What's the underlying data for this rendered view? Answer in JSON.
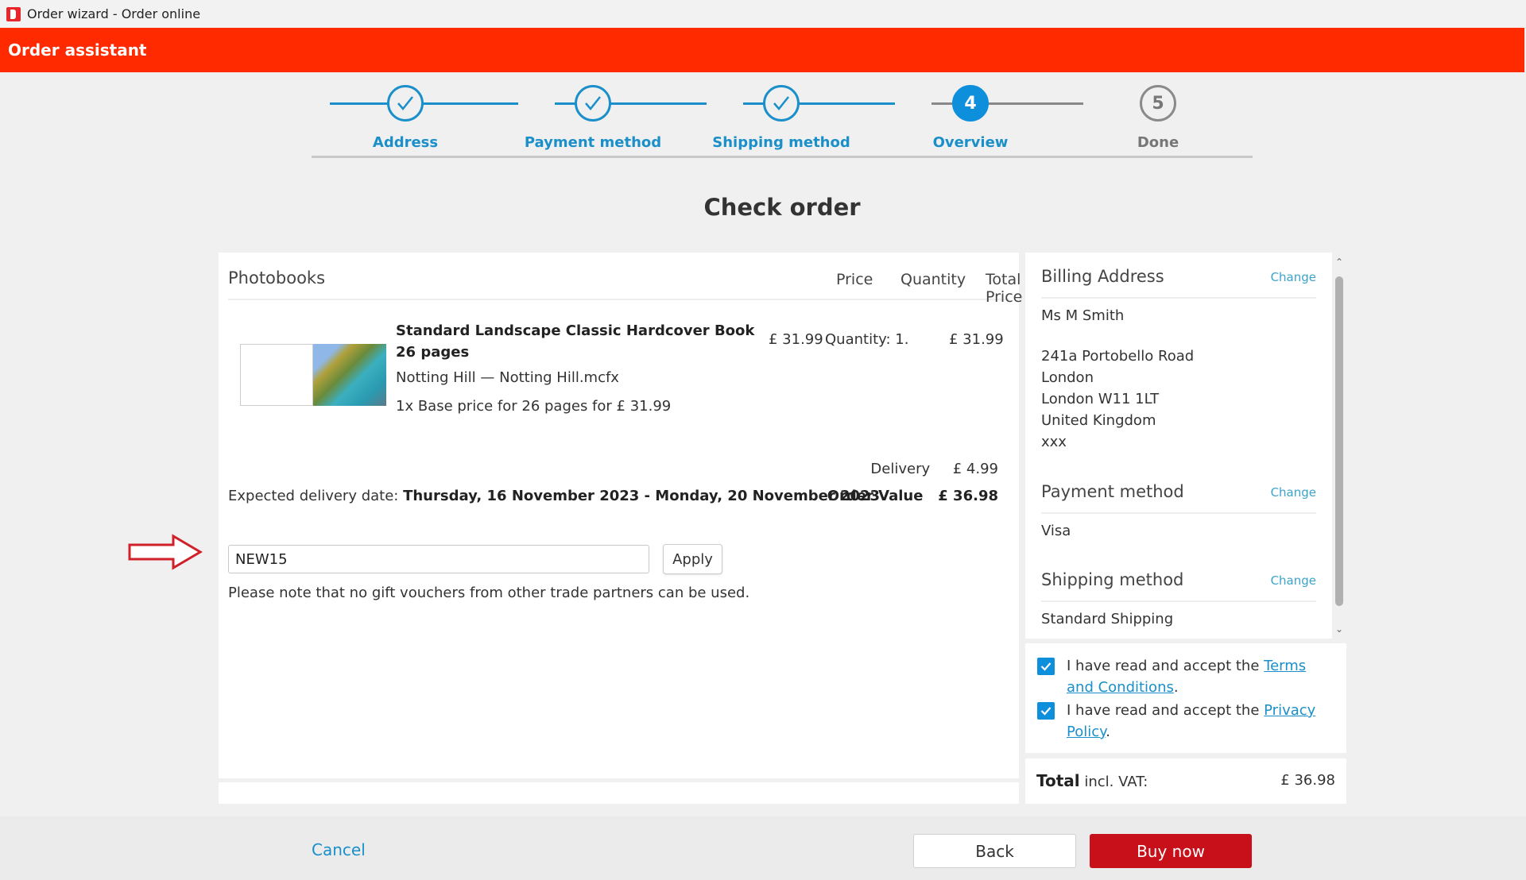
{
  "window": {
    "title": "Order wizard - Order online"
  },
  "header": {
    "title": "Order assistant"
  },
  "colors": {
    "brand_red": "#ff2a00",
    "accent_blue": "#0d8fdb",
    "buy_button": "#c8101a"
  },
  "stepper": {
    "steps": [
      {
        "label": "Address",
        "state": "done",
        "icon": "check-icon"
      },
      {
        "label": "Payment method",
        "state": "done",
        "icon": "check-icon"
      },
      {
        "label": "Shipping method",
        "state": "done",
        "icon": "check-icon"
      },
      {
        "label": "Overview",
        "state": "active",
        "number": "4"
      },
      {
        "label": "Done",
        "state": "pending",
        "number": "5"
      }
    ]
  },
  "page": {
    "title": "Check order"
  },
  "order": {
    "section_title": "Photobooks",
    "columns": {
      "price": "Price",
      "quantity": "Quantity",
      "total": "Total Price"
    },
    "item": {
      "title_line1": "Standard Landscape Classic Hardcover Book",
      "title_line2": "26 pages",
      "file": "Notting Hill — Notting Hill.mcfx",
      "base_price": "1x Base price for 26 pages for £ 31.99",
      "price": "£ 31.99",
      "quantity": "Quantity: 1.",
      "total": "£ 31.99"
    },
    "delivery_label": "Delivery",
    "delivery_value": "£ 4.99",
    "expected_label": "Expected delivery date:",
    "expected_value": "Thursday, 16 November 2023 - Monday, 20 November 2023",
    "order_value_label": "Order Value",
    "order_value": "£ 36.98"
  },
  "voucher": {
    "value": "NEW15",
    "apply_label": "Apply",
    "note": "Please note that no gift vouchers from other trade partners can be used."
  },
  "summary": {
    "billing": {
      "title": "Billing Address",
      "change": "Change",
      "name": "Ms M Smith",
      "lines": [
        "241a Portobello Road",
        "London",
        "London W11 1LT",
        "United Kingdom",
        "xxx"
      ]
    },
    "payment": {
      "title": "Payment method",
      "change": "Change",
      "value": "Visa"
    },
    "shipping": {
      "title": "Shipping method",
      "change": "Change",
      "value": "Standard Shipping"
    }
  },
  "terms": {
    "prefix": "I have read and accept the",
    "terms_link": "Terms and Conditions",
    "privacy_link": "Privacy Policy",
    "terms_checked": true,
    "privacy_checked": true
  },
  "total": {
    "label_bold": "Total",
    "label_rest": "incl. VAT:",
    "value": "£ 36.98"
  },
  "footer": {
    "cancel": "Cancel",
    "back": "Back",
    "buy": "Buy now"
  }
}
